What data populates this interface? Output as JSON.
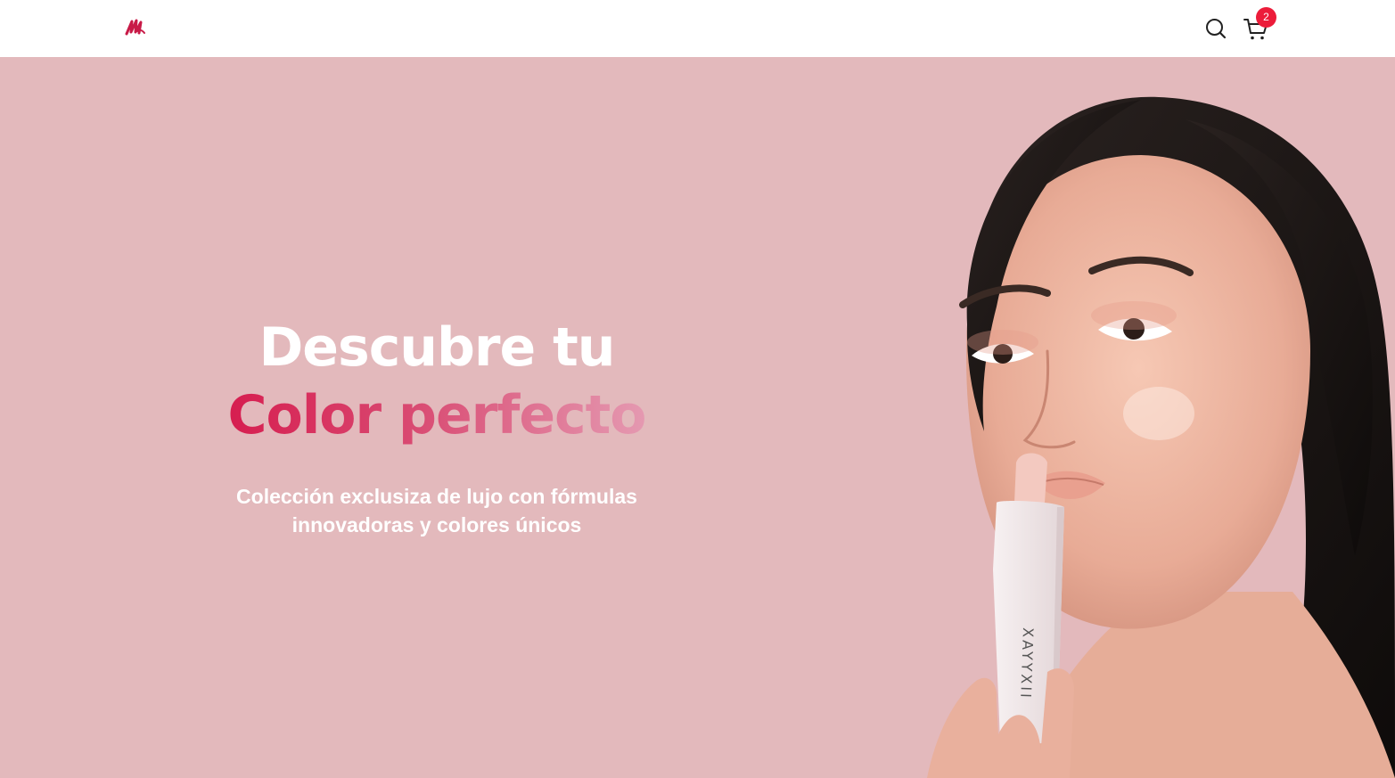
{
  "header": {
    "logo_icon": "lipstick-scribble-logo",
    "search_icon": "search-icon",
    "cart_icon": "cart-icon",
    "cart_count": "2"
  },
  "hero": {
    "title_line1": "Descubre tu",
    "title_line2": "Color perfecto",
    "subtitle_line1": "Colección exclusiza de lujo con fórmulas",
    "subtitle_line2": "innovadoras y colores únicos",
    "lipstick_brand": "XAYYXII"
  },
  "colors": {
    "hero_bg": "#e3b9bc",
    "accent": "#d6184b",
    "badge": "#ec1c3a"
  }
}
